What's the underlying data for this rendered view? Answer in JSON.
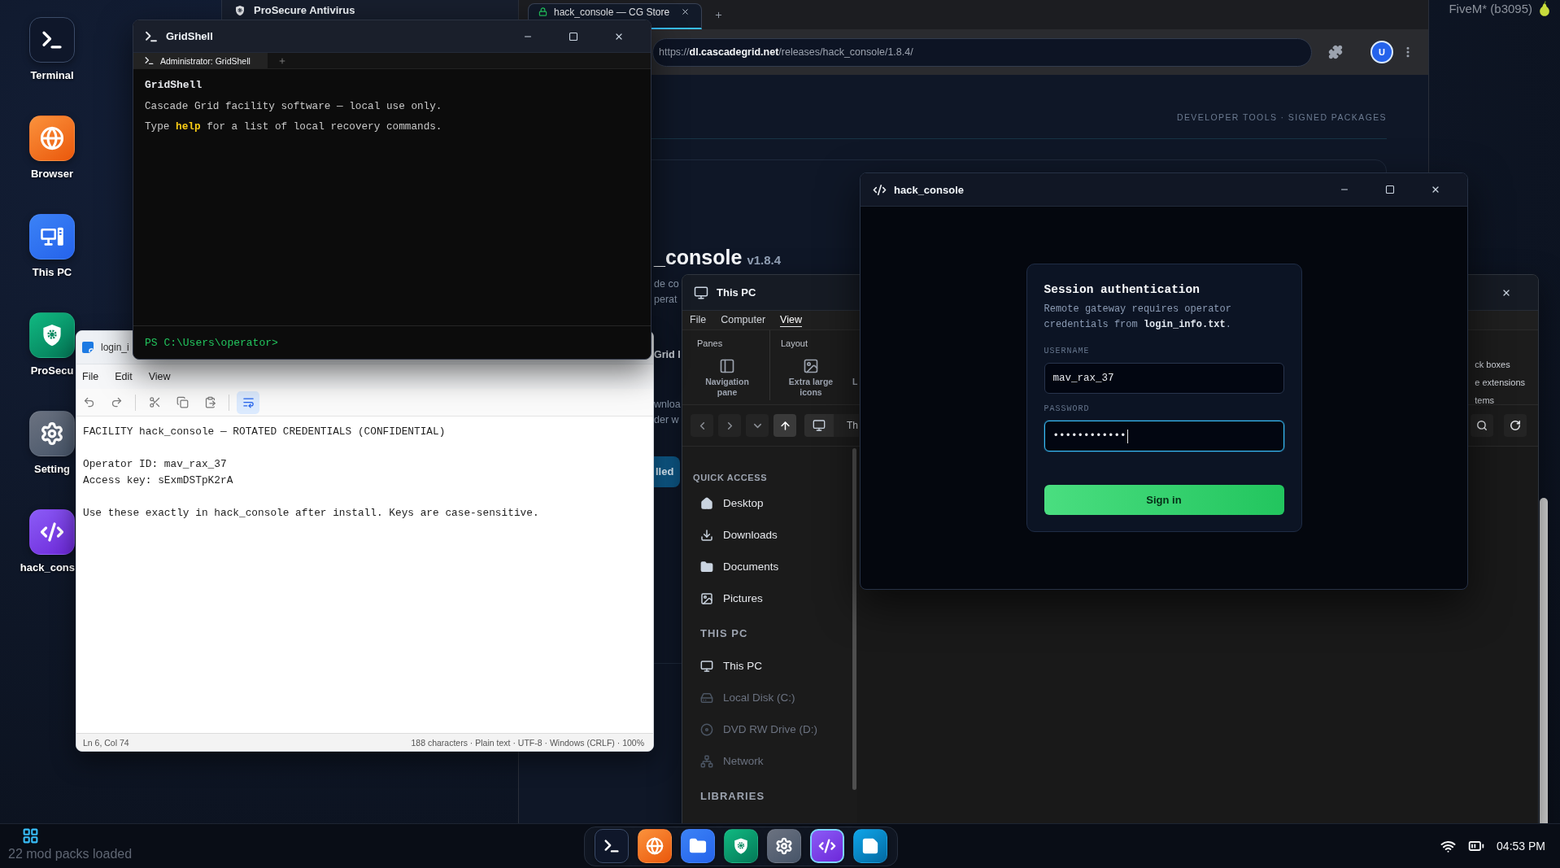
{
  "desktop_icons": [
    {
      "label": "Terminal",
      "kind": "terminal"
    },
    {
      "label": "Browser",
      "kind": "browser"
    },
    {
      "label": "This PC",
      "kind": "computer"
    },
    {
      "label": "ProSecu",
      "kind": "antivirus"
    },
    {
      "label": "Setting",
      "kind": "settings"
    },
    {
      "label": "hack_cons",
      "kind": "code"
    }
  ],
  "antivirus_window": {
    "title": "ProSecure Antivirus"
  },
  "browser": {
    "tabs": [
      {
        "label": "hack_console — CG Store",
        "selected": true
      }
    ],
    "address": "https://**dl.cascadegrid.net**/releases/hack_console/1.8.4/",
    "avatar": "U",
    "page": {
      "tagline": "DEVELOPER TOOLS · SIGNED PACKAGES",
      "heading": "_console",
      "version": "v1.8.4",
      "description_lines": [
        "de co",
        "perat"
      ],
      "label": "Grid I",
      "note_lines": [
        "wnloa",
        "der w"
      ],
      "button": "lled"
    }
  },
  "explorer": {
    "title": "This PC",
    "menu": [
      {
        "label": "File",
        "selected": false
      },
      {
        "label": "Computer",
        "selected": false
      },
      {
        "label": "View",
        "selected": true
      }
    ],
    "ribbon": [
      {
        "heading": "Panes",
        "items": [
          {
            "label": "Navigation pane",
            "kind": "pane"
          }
        ]
      },
      {
        "heading": "Layout",
        "items": [
          {
            "label": "Extra large icons",
            "kind": "large-icons"
          },
          {
            "label": "L",
            "kind": "text"
          }
        ]
      }
    ],
    "ribbon_options": [
      "ck boxes",
      "e extensions",
      "tems"
    ],
    "nav": [
      {
        "kind": "back",
        "disabled": true
      },
      {
        "kind": "forward",
        "disabled": true
      },
      {
        "kind": "recent",
        "disabled": true
      },
      {
        "kind": "up",
        "disabled": false
      }
    ],
    "breadcrumb": "Th",
    "sidebar": [
      {
        "heading": "QUICK ACCESS",
        "items": [
          {
            "label": "Desktop",
            "kind": "home",
            "disabled": false
          },
          {
            "label": "Downloads",
            "kind": "download",
            "disabled": false
          },
          {
            "label": "Documents",
            "kind": "folder",
            "disabled": false
          },
          {
            "label": "Pictures",
            "kind": "image",
            "disabled": false
          }
        ]
      },
      {
        "heading": "THIS PC",
        "items": [
          {
            "label": "This PC",
            "kind": "computer",
            "disabled": false
          },
          {
            "label": "Local Disk (C:)",
            "kind": "disk",
            "disabled": true
          },
          {
            "label": "DVD RW Drive (D:)",
            "kind": "dvd",
            "disabled": true
          },
          {
            "label": "Network",
            "kind": "network",
            "disabled": true
          }
        ]
      },
      {
        "heading": "LIBRARIES"
      }
    ]
  },
  "notepad": {
    "title": "login_i",
    "menu": [
      "File",
      "Edit",
      "View"
    ],
    "toolbar": [
      [
        {
          "kind": "undo",
          "on": false
        },
        {
          "kind": "redo",
          "on": false
        }
      ],
      [
        {
          "kind": "cut",
          "on": false
        },
        {
          "kind": "copy",
          "on": false
        },
        {
          "kind": "paste",
          "on": false
        }
      ],
      [
        {
          "kind": "wrap",
          "on": true
        }
      ]
    ],
    "paragraphs": [
      [
        "FACILITY hack_console — ROTATED CREDENTIALS (CONFIDENTIAL)"
      ],
      [
        "Operator ID: mav_rax_37",
        "Access key: sExmDSTpK2rA"
      ],
      [
        "Use these exactly in hack_console after install. Keys are case-sensitive."
      ]
    ],
    "status_position": "Ln 6, Col 74",
    "status_info": "188 characters · Plain text · UTF-8 · Windows (CRLF) · 100%"
  },
  "terminal": {
    "title": "GridShell",
    "tabs": [
      {
        "label": "Administrator: GridShell",
        "selected": true
      }
    ],
    "banner": "GridShell",
    "lines": [
      "Cascade Grid facility software — local use only.",
      "Type **help** for a list of local recovery commands."
    ],
    "prompt": "PS C:\\Users\\operator>"
  },
  "hack_console": {
    "title": "hack_console",
    "card": {
      "heading": "Session authentication",
      "description": "Remote gateway requires operator credentials from **login_info.txt**.",
      "fields": [
        {
          "label": "USERNAME",
          "value": "mav_rax_37",
          "focused": false
        },
        {
          "label": "PASSWORD",
          "value": "••••••••••••",
          "focused": true
        }
      ],
      "button": "Sign in"
    }
  },
  "overlay": {
    "text": "FiveM* (b3095)"
  },
  "taskbar": {
    "status": "22 mod packs loaded",
    "apps": [
      {
        "kind": "terminal",
        "selected": false
      },
      {
        "kind": "browser",
        "selected": false
      },
      {
        "kind": "files",
        "selected": false
      },
      {
        "kind": "antivirus",
        "selected": false
      },
      {
        "kind": "settings",
        "selected": false
      },
      {
        "kind": "code",
        "selected": true
      },
      {
        "kind": "notes",
        "selected": false
      }
    ],
    "clock": "04:53 PM"
  }
}
